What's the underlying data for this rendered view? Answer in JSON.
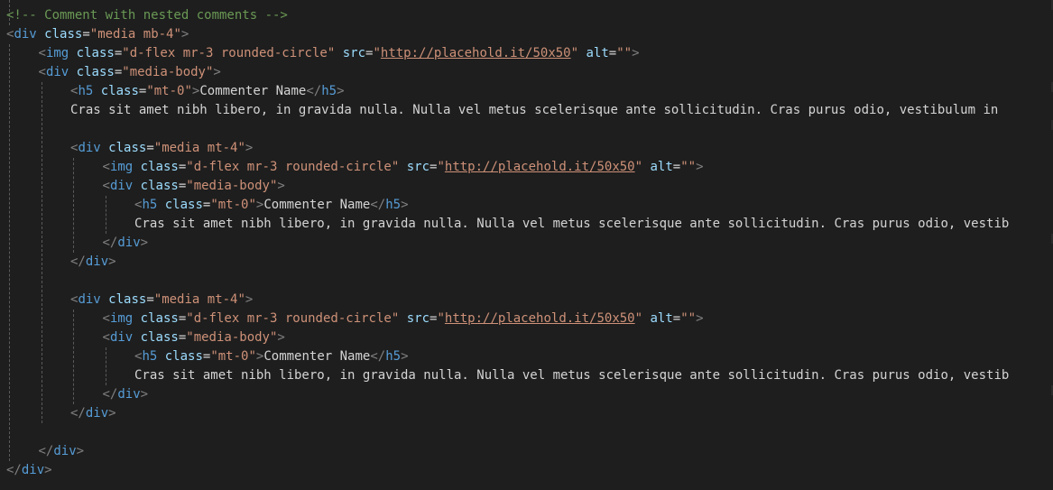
{
  "editor": {
    "language": "html",
    "colors": {
      "background": "#1e1e1e",
      "tag": "#569cd6",
      "attribute": "#9cdcfe",
      "string": "#ce9178",
      "text": "#d4d4d4",
      "punctuation": "#808080",
      "comment": "#6a9955",
      "indent_guide": "#5a5a5a"
    },
    "lines": [
      {
        "indent": 0,
        "tokens": [
          [
            "comment",
            "<!-- Comment with nested comments -->"
          ]
        ]
      },
      {
        "indent": 0,
        "tokens": [
          [
            "punct",
            "<"
          ],
          [
            "tag",
            "div"
          ],
          [
            "text",
            " "
          ],
          [
            "attr",
            "class"
          ],
          [
            "eq",
            "="
          ],
          [
            "str",
            "\"media mb-4\""
          ],
          [
            "punct",
            ">"
          ]
        ]
      },
      {
        "indent": 1,
        "tokens": [
          [
            "punct",
            "<"
          ],
          [
            "tag",
            "img"
          ],
          [
            "text",
            " "
          ],
          [
            "attr",
            "class"
          ],
          [
            "eq",
            "="
          ],
          [
            "str",
            "\"d-flex mr-3 rounded-circle\""
          ],
          [
            "text",
            " "
          ],
          [
            "attr",
            "src"
          ],
          [
            "eq",
            "="
          ],
          [
            "str",
            "\""
          ],
          [
            "link",
            "http://placehold.it/50x50"
          ],
          [
            "str",
            "\""
          ],
          [
            "text",
            " "
          ],
          [
            "attr",
            "alt"
          ],
          [
            "eq",
            "="
          ],
          [
            "str",
            "\"\""
          ],
          [
            "punct",
            ">"
          ]
        ]
      },
      {
        "indent": 1,
        "tokens": [
          [
            "punct",
            "<"
          ],
          [
            "tag",
            "div"
          ],
          [
            "text",
            " "
          ],
          [
            "attr",
            "class"
          ],
          [
            "eq",
            "="
          ],
          [
            "str",
            "\"media-body\""
          ],
          [
            "punct",
            ">"
          ]
        ]
      },
      {
        "indent": 2,
        "tokens": [
          [
            "punct",
            "<"
          ],
          [
            "tag",
            "h5"
          ],
          [
            "text",
            " "
          ],
          [
            "attr",
            "class"
          ],
          [
            "eq",
            "="
          ],
          [
            "str",
            "\"mt-0\""
          ],
          [
            "punct",
            ">"
          ],
          [
            "text",
            "Commenter Name"
          ],
          [
            "punct",
            "</"
          ],
          [
            "tag",
            "h5"
          ],
          [
            "punct",
            ">"
          ]
        ]
      },
      {
        "indent": 2,
        "tokens": [
          [
            "text",
            "Cras sit amet nibh libero, in gravida nulla. Nulla vel metus scelerisque ante sollicitudin. Cras purus odio, vestibulum in"
          ]
        ]
      },
      {
        "indent": 0,
        "tokens": []
      },
      {
        "indent": 2,
        "tokens": [
          [
            "punct",
            "<"
          ],
          [
            "tag",
            "div"
          ],
          [
            "text",
            " "
          ],
          [
            "attr",
            "class"
          ],
          [
            "eq",
            "="
          ],
          [
            "str",
            "\"media mt-4\""
          ],
          [
            "punct",
            ">"
          ]
        ]
      },
      {
        "indent": 3,
        "tokens": [
          [
            "punct",
            "<"
          ],
          [
            "tag",
            "img"
          ],
          [
            "text",
            " "
          ],
          [
            "attr",
            "class"
          ],
          [
            "eq",
            "="
          ],
          [
            "str",
            "\"d-flex mr-3 rounded-circle\""
          ],
          [
            "text",
            " "
          ],
          [
            "attr",
            "src"
          ],
          [
            "eq",
            "="
          ],
          [
            "str",
            "\""
          ],
          [
            "link",
            "http://placehold.it/50x50"
          ],
          [
            "str",
            "\""
          ],
          [
            "text",
            " "
          ],
          [
            "attr",
            "alt"
          ],
          [
            "eq",
            "="
          ],
          [
            "str",
            "\"\""
          ],
          [
            "punct",
            ">"
          ]
        ]
      },
      {
        "indent": 3,
        "tokens": [
          [
            "punct",
            "<"
          ],
          [
            "tag",
            "div"
          ],
          [
            "text",
            " "
          ],
          [
            "attr",
            "class"
          ],
          [
            "eq",
            "="
          ],
          [
            "str",
            "\"media-body\""
          ],
          [
            "punct",
            ">"
          ]
        ]
      },
      {
        "indent": 4,
        "tokens": [
          [
            "punct",
            "<"
          ],
          [
            "tag",
            "h5"
          ],
          [
            "text",
            " "
          ],
          [
            "attr",
            "class"
          ],
          [
            "eq",
            "="
          ],
          [
            "str",
            "\"mt-0\""
          ],
          [
            "punct",
            ">"
          ],
          [
            "text",
            "Commenter Name"
          ],
          [
            "punct",
            "</"
          ],
          [
            "tag",
            "h5"
          ],
          [
            "punct",
            ">"
          ]
        ]
      },
      {
        "indent": 4,
        "tokens": [
          [
            "text",
            "Cras sit amet nibh libero, in gravida nulla. Nulla vel metus scelerisque ante sollicitudin. Cras purus odio, vestib"
          ]
        ]
      },
      {
        "indent": 3,
        "tokens": [
          [
            "punct",
            "</"
          ],
          [
            "tag",
            "div"
          ],
          [
            "punct",
            ">"
          ]
        ]
      },
      {
        "indent": 2,
        "tokens": [
          [
            "punct",
            "</"
          ],
          [
            "tag",
            "div"
          ],
          [
            "punct",
            ">"
          ]
        ]
      },
      {
        "indent": 0,
        "tokens": []
      },
      {
        "indent": 2,
        "tokens": [
          [
            "punct",
            "<"
          ],
          [
            "tag",
            "div"
          ],
          [
            "text",
            " "
          ],
          [
            "attr",
            "class"
          ],
          [
            "eq",
            "="
          ],
          [
            "str",
            "\"media mt-4\""
          ],
          [
            "punct",
            ">"
          ]
        ]
      },
      {
        "indent": 3,
        "tokens": [
          [
            "punct",
            "<"
          ],
          [
            "tag",
            "img"
          ],
          [
            "text",
            " "
          ],
          [
            "attr",
            "class"
          ],
          [
            "eq",
            "="
          ],
          [
            "str",
            "\"d-flex mr-3 rounded-circle\""
          ],
          [
            "text",
            " "
          ],
          [
            "attr",
            "src"
          ],
          [
            "eq",
            "="
          ],
          [
            "str",
            "\""
          ],
          [
            "link",
            "http://placehold.it/50x50"
          ],
          [
            "str",
            "\""
          ],
          [
            "text",
            " "
          ],
          [
            "attr",
            "alt"
          ],
          [
            "eq",
            "="
          ],
          [
            "str",
            "\"\""
          ],
          [
            "punct",
            ">"
          ]
        ]
      },
      {
        "indent": 3,
        "tokens": [
          [
            "punct",
            "<"
          ],
          [
            "tag",
            "div"
          ],
          [
            "text",
            " "
          ],
          [
            "attr",
            "class"
          ],
          [
            "eq",
            "="
          ],
          [
            "str",
            "\"media-body\""
          ],
          [
            "punct",
            ">"
          ]
        ]
      },
      {
        "indent": 4,
        "tokens": [
          [
            "punct",
            "<"
          ],
          [
            "tag",
            "h5"
          ],
          [
            "text",
            " "
          ],
          [
            "attr",
            "class"
          ],
          [
            "eq",
            "="
          ],
          [
            "str",
            "\"mt-0\""
          ],
          [
            "punct",
            ">"
          ],
          [
            "text",
            "Commenter Name"
          ],
          [
            "punct",
            "</"
          ],
          [
            "tag",
            "h5"
          ],
          [
            "punct",
            ">"
          ]
        ]
      },
      {
        "indent": 4,
        "tokens": [
          [
            "text",
            "Cras sit amet nibh libero, in gravida nulla. Nulla vel metus scelerisque ante sollicitudin. Cras purus odio, vestib"
          ]
        ]
      },
      {
        "indent": 3,
        "tokens": [
          [
            "punct",
            "</"
          ],
          [
            "tag",
            "div"
          ],
          [
            "punct",
            ">"
          ]
        ]
      },
      {
        "indent": 2,
        "tokens": [
          [
            "punct",
            "</"
          ],
          [
            "tag",
            "div"
          ],
          [
            "punct",
            ">"
          ]
        ]
      },
      {
        "indent": 0,
        "tokens": []
      },
      {
        "indent": 1,
        "tokens": [
          [
            "punct",
            "</"
          ],
          [
            "tag",
            "div"
          ],
          [
            "punct",
            ">"
          ]
        ]
      },
      {
        "indent": 0,
        "tokens": [
          [
            "punct",
            "</"
          ],
          [
            "tag",
            "div"
          ],
          [
            "punct",
            ">"
          ]
        ]
      }
    ]
  }
}
